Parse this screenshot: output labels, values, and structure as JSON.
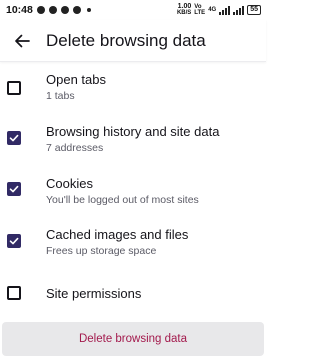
{
  "status_bar": {
    "time": "10:48",
    "net_speed_value": "1.00",
    "net_speed_unit": "KB/S",
    "vo_label_top": "Vo",
    "vo_label_bottom": "LTE",
    "network": "4G",
    "battery": "55"
  },
  "app_bar": {
    "back_icon": "arrow-left-icon",
    "title": "Delete browsing data"
  },
  "options": [
    {
      "title": "Open tabs",
      "subtitle": "1 tabs",
      "checked": false
    },
    {
      "title": "Browsing history and site data",
      "subtitle": "7 addresses",
      "checked": true
    },
    {
      "title": "Cookies",
      "subtitle": "You'll be logged out of most sites",
      "checked": true
    },
    {
      "title": "Cached images and files",
      "subtitle": "Frees up storage space",
      "checked": true
    },
    {
      "title": "Site permissions",
      "subtitle": "",
      "checked": false
    }
  ],
  "action": {
    "label": "Delete browsing data"
  },
  "colors": {
    "accent": "#312a65",
    "danger_text": "#a31a4d",
    "button_bg": "#e8e8ea"
  }
}
